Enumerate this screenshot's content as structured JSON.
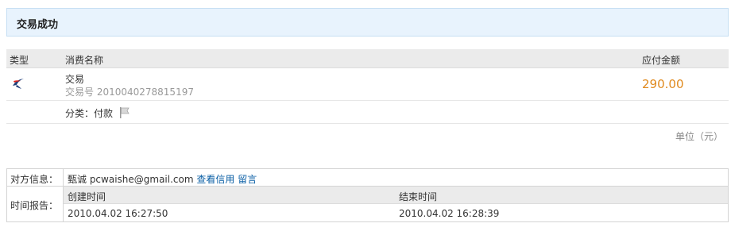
{
  "header": {
    "title": "交易成功"
  },
  "transaction_table": {
    "columns": {
      "type": "类型",
      "name": "消费名称",
      "amount": "应付金额"
    },
    "row": {
      "icon": "swallow-logo-icon",
      "name": "交易",
      "number": "交易号 2010040278815197",
      "amount": "290.00"
    },
    "category": {
      "label": "分类：付款",
      "icon": "flag-icon"
    },
    "unit": "单位（元）"
  },
  "counterparty": {
    "label": "对方信息：",
    "name": "甄诚 pcwaishe@gmail.com",
    "view_credit_link": "查看信用",
    "message_link": "留言"
  },
  "time_report": {
    "label": "时间报告：",
    "created_header": "创建时间",
    "ended_header": "结束时间",
    "created_value": "2010.04.02 16:27:50",
    "ended_value": "2010.04.02 16:28:39"
  },
  "colors": {
    "amount": "#e08a1e",
    "link": "#0b5fa5",
    "title_bg": "#e8f3fd"
  }
}
